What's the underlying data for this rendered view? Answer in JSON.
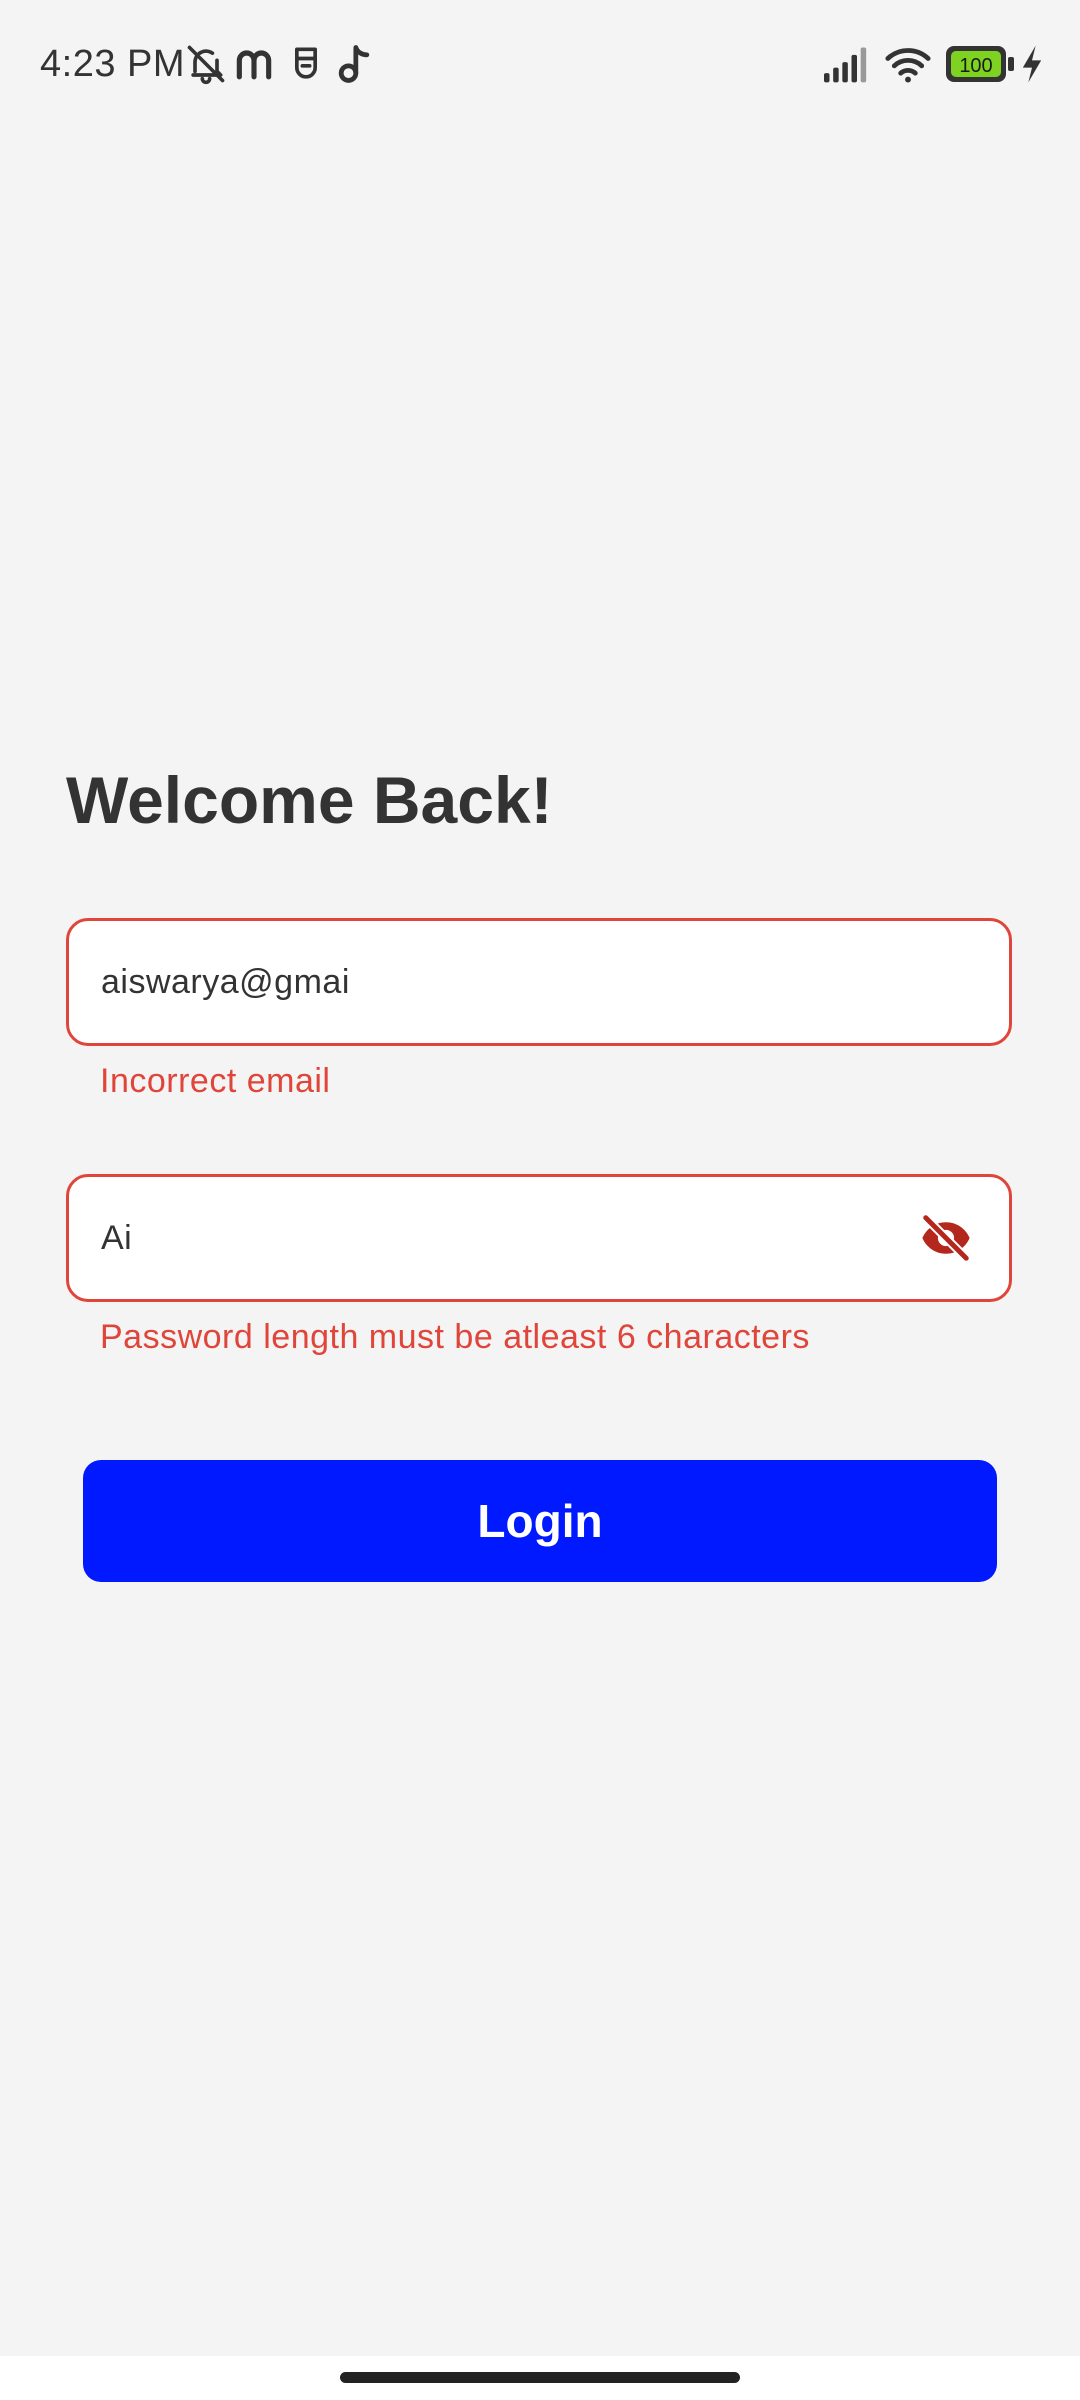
{
  "status_bar": {
    "time": "4:23 PM",
    "battery_level": "100",
    "left_icons": [
      "bell-off-icon",
      "m-app-icon",
      "mask-app-icon",
      "music-note-icon"
    ],
    "right_icons": [
      "signal-icon",
      "wifi-icon",
      "battery-icon",
      "charging-bolt-icon"
    ]
  },
  "login": {
    "title": "Welcome Back!",
    "email": {
      "value": "aiswarya@gmai",
      "error": "Incorrect email"
    },
    "password": {
      "value": "Ai",
      "error": "Password length must be atleast 6 characters",
      "toggle_icon": "visibility-off-icon"
    },
    "login_label": "Login"
  },
  "colors": {
    "background": "#f4f4f4",
    "error": "#e0453a",
    "primary_button": "#0019ff",
    "text": "#333333"
  }
}
